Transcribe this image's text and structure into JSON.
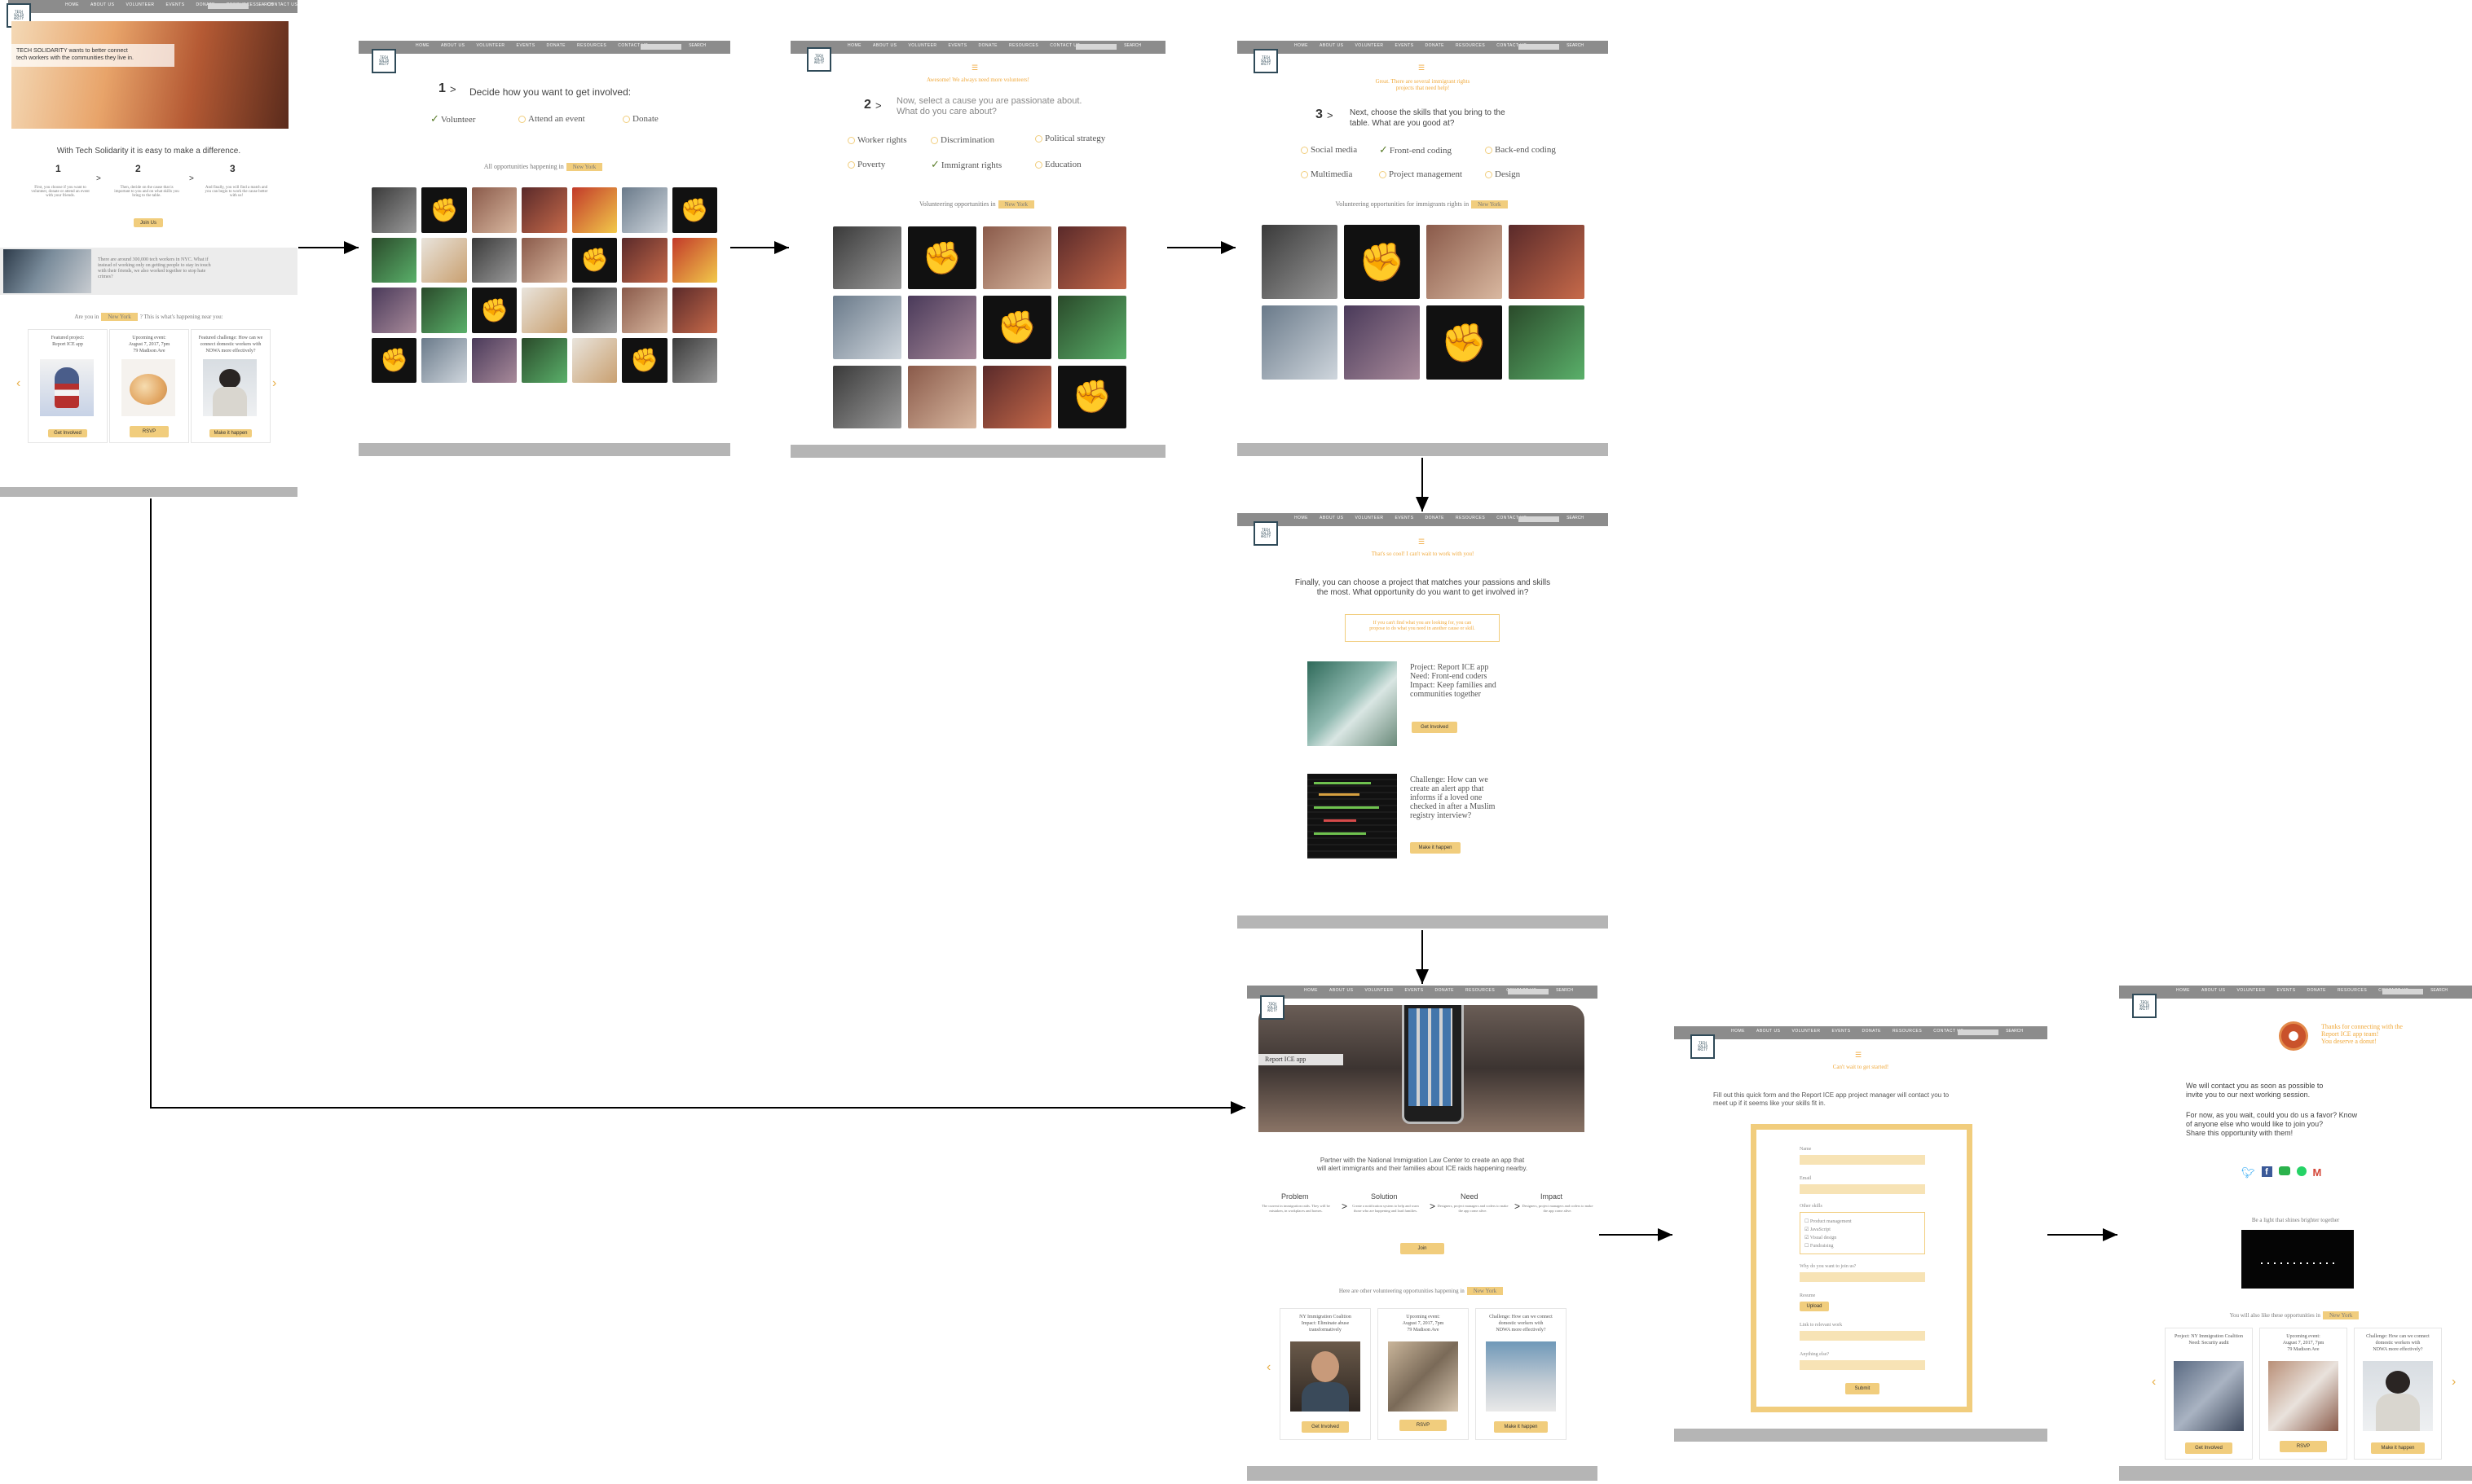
{
  "nav": {
    "items": [
      "HOME",
      "ABOUT US",
      "VOLUNTEER",
      "EVENTS",
      "DONATE",
      "RESOURCES",
      "CONTACT US"
    ],
    "search": "SEARCH",
    "logo": "TECH\nSOLID\nARITY"
  },
  "colors": {
    "accent": "#f1cd7d",
    "orange": "#f0a93c",
    "navbar": "#8c8c8c",
    "footer": "#b5b5b5",
    "logo": "#2f4a58"
  },
  "home": {
    "hero_text": "TECH SOLIDARITY wants to better connect\ntech workers with the communities they live in.",
    "headline": "With Tech Solidarity it is easy to make a difference.",
    "steps": [
      {
        "num": "1",
        "text": "First, you choose if you want to volunteer, donate or attend an event with your friends."
      },
      {
        "num": "2",
        "text": "Then, decide on the cause that is important to you and on what skills you bring to the table."
      },
      {
        "num": "3",
        "text": "And finally, you will find a match and you can begin to work the cause better with us!"
      }
    ],
    "join_btn": "Join Us",
    "band_text": "There are around 300,000 tech workers in NYC. What if instead of working only on getting people to stay in touch with their friends, we also worked together to stop hate crimes?",
    "near_prefix": "Are you in",
    "near_city": "New York",
    "near_suffix": "? This is what's happening near you:",
    "cards": [
      {
        "text": "Featured project:\nReport ICE app",
        "btn": "Get Involved"
      },
      {
        "text": "Upcoming event:\nAugust 7, 2017, 7pm\n79 Madison Ave",
        "btn": "RSVP"
      },
      {
        "text": "Featured challenge: How can we\nconnect domestic workers with\nNDWA more effectively?",
        "btn": "Make it happen"
      }
    ]
  },
  "step1": {
    "num": "1",
    "prompt": "Decide how you want to get involved:",
    "options": [
      "Volunteer",
      "Attend an event",
      "Donate"
    ],
    "checked": 0,
    "filter_prefix": "All opportunities happening in",
    "city": "New York"
  },
  "step2": {
    "top_note": "Awesome! We always need more volunteers!",
    "num": "2",
    "prompt": "Now, select a cause you are passionate about.\nWhat do you care about?",
    "options": [
      "Worker rights",
      "Discrimination",
      "Political strategy",
      "Poverty",
      "Immigrant rights",
      "Education"
    ],
    "checked": 4,
    "filter_prefix": "Volunteering opportunities in",
    "city": "New York"
  },
  "step3": {
    "top_note": "Great. There are several immigrant rights\nprojects that need help!",
    "num": "3",
    "prompt": "Next, choose the skills that you bring to the\ntable. What are you good at?",
    "options": [
      "Social media",
      "Front-end coding",
      "Back-end coding",
      "Multimedia",
      "Project management",
      "Design"
    ],
    "checked": 1,
    "filter_prefix": "Volunteering opportunities for immigrants rights in",
    "city": "New York"
  },
  "step4": {
    "top_note": "That's so cool! I can't wait to work with you!",
    "prompt": "Finally, you can choose a project that matches your passions and skills\nthe most. What opportunity do you want to get involved in?",
    "notice": "If you can't find what you are looking for, you can\npropose to do what you need in another cause or skill.",
    "items": [
      {
        "text": "Project: Report ICE app\nNeed: Front-end coders\nImpact: Keep families and\ncommunities together",
        "btn": "Get Involved"
      },
      {
        "text": "Challenge: How can we\ncreate an alert app that\ninforms if a loved one\nchecked in after a Muslim\nregistry interview?",
        "btn": "Make it happen"
      }
    ]
  },
  "project": {
    "badge": "Report ICE app",
    "desc": "Partner with the National Immigration Law Center to create an app that\nwill alert immigrants and their families about ICE raids happening nearby.",
    "flow": [
      {
        "title": "Problem",
        "text": "The current in immigration raids. They will be mistaken, in workplaces and homes."
      },
      {
        "title": "Solution",
        "text": "Create a notification system to help and warn those who are happening and load families."
      },
      {
        "title": "Need",
        "text": "Designers, project managers and coders to make the app come alive."
      },
      {
        "title": "Impact",
        "text": "Designers, project managers and coders to make the app come alive."
      }
    ],
    "join_btn": "Join",
    "other_prefix": "Here are other volunteering opportunities happening in",
    "city": "New York",
    "cards": [
      {
        "text": "NY Immigration Coalition\nImpact: Eliminate abuse\ntransformatively",
        "btn": "Get Involved"
      },
      {
        "text": "Upcoming event:\nAugust 7, 2017, 7pm\n79 Madison Ave",
        "btn": "RSVP"
      },
      {
        "text": "Challenge: How can we connect\ndomestic workers with\nNDWA more effectively?",
        "btn": "Make it happen"
      }
    ]
  },
  "form": {
    "top_note": "Can't wait to get started!",
    "intro": "Fill out this quick form and the Report ICE app project manager will contact you to\nmeet up if it seems like your skills fit in.",
    "labels": [
      "Name",
      "Email",
      "Other skills",
      "Why do you want to join us?",
      "Resume",
      "Link to relevant work",
      "Anything else?"
    ],
    "skills": [
      "Product management",
      "JavaScript",
      "Visual design",
      "Fundraising"
    ],
    "upload": "Upload",
    "submit": "Submit"
  },
  "thanks": {
    "note": "Thanks for connecting with the\nReport ICE app team!\nYou deserve a donut!",
    "p1": "We will contact you as soon as possible to\ninvite you to our next working session.",
    "p2": "For now, as you wait, could you do us a favor? Know\nof anyone else who would like to join you?\nShare this opportunity with them!",
    "video_caption": "Be a light that shines brighter together",
    "also_prefix": "You will also like these opportunities in",
    "city": "New York",
    "cards": [
      {
        "text": "Project: NY Immigration Coalition\nNeed: Security audit",
        "btn": "Get Involved"
      },
      {
        "text": "Upcoming event:\nAugust 7, 2017, 7pm\n79 Madison Ave",
        "btn": "RSVP"
      },
      {
        "text": "Challenge: How can we connect\ndomestic workers with\nNDWA more effectively?",
        "btn": "Make it happen"
      }
    ]
  }
}
